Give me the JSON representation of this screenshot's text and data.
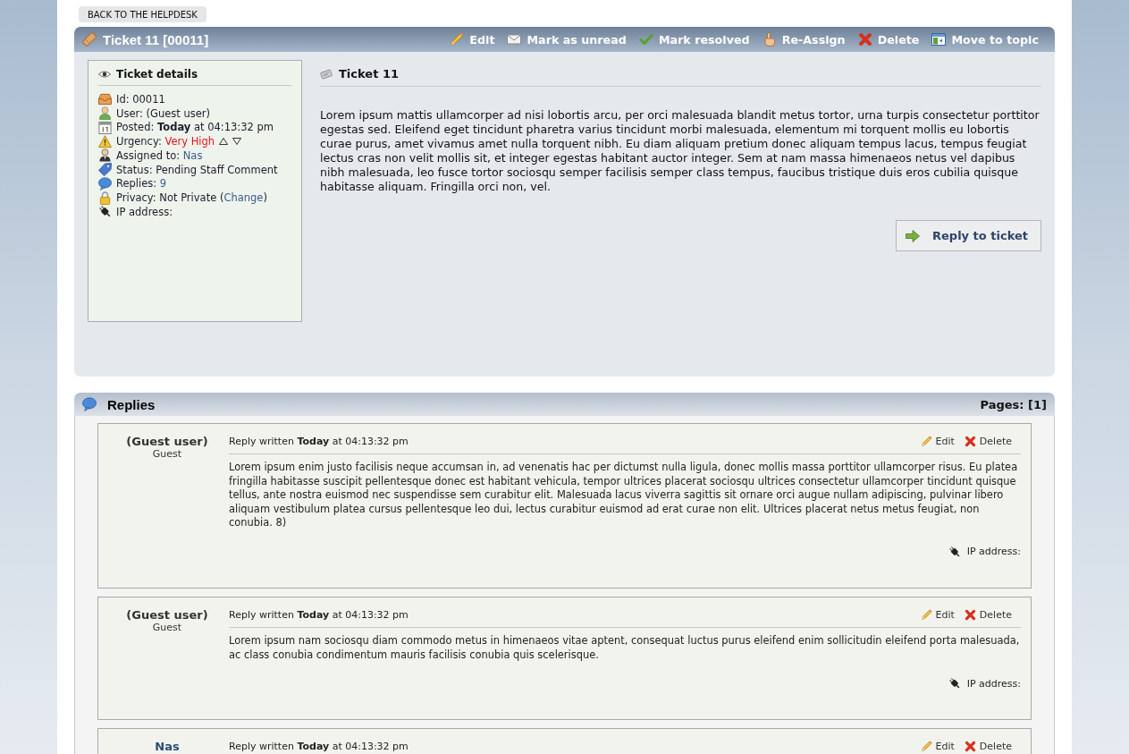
{
  "back_button": "BACK TO THE HELPDESK",
  "ticket": {
    "title": "Ticket 11 [00011]",
    "actions": [
      {
        "kind": "edit",
        "label": "Edit"
      },
      {
        "kind": "unread",
        "label": "Mark as unread"
      },
      {
        "kind": "resolve",
        "label": "Mark resolved"
      },
      {
        "kind": "reassign",
        "label": "Re-Assign"
      },
      {
        "kind": "delete",
        "label": "Delete"
      },
      {
        "kind": "move",
        "label": "Move to topic"
      }
    ],
    "details": {
      "title": "Ticket details",
      "fields": [
        {
          "kind": "id",
          "text": "Id: 00011"
        },
        {
          "kind": "user",
          "text": "User: (Guest user)"
        },
        {
          "kind": "posted",
          "text": "Posted: **Today** at 04:13:32 pm"
        },
        {
          "kind": "urgency",
          "text": "Urgency: ",
          "value": "Very High"
        },
        {
          "kind": "assigned",
          "text": "Assigned to: ",
          "link": "Nas"
        },
        {
          "kind": "status",
          "text": "Status: Pending Staff Comment"
        },
        {
          "kind": "replies",
          "text": "Replies: ",
          "link": "9"
        },
        {
          "kind": "privacy",
          "text": "Privacy: Not Private (",
          "link": "Change",
          "suffix": ")"
        },
        {
          "kind": "ip",
          "text": "IP address:"
        }
      ]
    },
    "subject": "Ticket 11",
    "body": "Lorem ipsum mattis ullamcorper ad nisi lobortis arcu, per orci malesuada blandit metus tortor, urna turpis consectetur porttitor egestas sed. Eleifend eget tincidunt pharetra varius tincidunt morbi malesuada, elementum mi torquent mollis eu lobortis curae purus, amet vivamus amet nulla torquent nibh. Eu diam aliquam pretium donec aliquam tempus lacus, tempus feugiat lectus cras non velit mollis sit, et integer egestas habitant auctor integer. Sem at nam massa himenaeos netus vel dapibus nibh malesuada, leo fusce tortor sociosqu semper facilisis semper class tempus, faucibus tristique duis eros cubilia quisque habitasse aliquam. Fringilla orci non, vel.",
    "reply_button": "Reply to ticket"
  },
  "replies": {
    "title": "Replies",
    "pages": "Pages: [1]",
    "items": [
      {
        "kind": "guest",
        "author": "(Guest user)",
        "role": "Guest",
        "meta": "Reply written **Today** at 04:13:32 pm",
        "actions": [
          {
            "kind": "edit",
            "label": "Edit"
          },
          {
            "kind": "delete",
            "label": "Delete"
          }
        ],
        "body": "Lorem ipsum enim justo facilisis neque accumsan in, ad venenatis hac per dictumst nulla ligula, donec mollis massa porttitor ullamcorper risus. Eu platea fringilla habitasse suscipit pellentesque donec est habitant vehicula, tempor ultrices placerat sociosqu ultrices consectetur ullamcorper tincidunt quisque tellus, ante nostra euismod nec suspendisse sem curabitur elit. Malesuada lacus viverra sagittis sit ornare orci augue nullam adipiscing, pulvinar libero aliquam vestibulum platea cursus pellentesque leo dui, lectus curabitur euismod ad erat curae non elit. Ultrices placerat netus metus feugiat, non conubia. 8)",
        "ip_label": "IP address:"
      },
      {
        "kind": "guest",
        "author": "(Guest user)",
        "role": "Guest",
        "meta": "Reply written **Today** at 04:13:32 pm",
        "actions": [
          {
            "kind": "edit",
            "label": "Edit"
          },
          {
            "kind": "delete",
            "label": "Delete"
          }
        ],
        "body": "Lorem ipsum nam sociosqu diam commodo metus in himenaeos vitae aptent, consequat luctus purus eleifend enim sollicitudin eleifend porta malesuada, ac class conubia condimentum mauris facilisis conubia quis scelerisque.",
        "ip_label": "IP address:"
      },
      {
        "kind": "staff",
        "author": "Nas",
        "meta": "Reply written **Today** at 04:13:32 pm",
        "actions": [
          {
            "kind": "edit",
            "label": "Edit"
          },
          {
            "kind": "delete",
            "label": "Delete"
          }
        ]
      }
    ]
  }
}
